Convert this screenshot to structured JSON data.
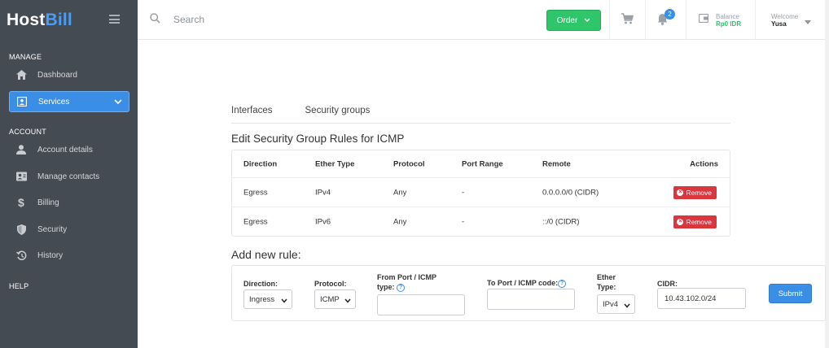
{
  "brand": {
    "host": "Host",
    "bill": "Bill"
  },
  "sidebar": {
    "sections": {
      "manage": "MANAGE",
      "account": "ACCOUNT",
      "help": "HELP"
    },
    "items": [
      {
        "label": "Dashboard",
        "icon": "home-icon"
      },
      {
        "label": "Services",
        "icon": "services-icon",
        "active": true
      },
      {
        "label": "Account details",
        "icon": "user-icon"
      },
      {
        "label": "Manage contacts",
        "icon": "contacts-icon"
      },
      {
        "label": "Billing",
        "icon": "dollar-icon"
      },
      {
        "label": "Security",
        "icon": "shield-icon"
      },
      {
        "label": "History",
        "icon": "history-icon"
      }
    ]
  },
  "topbar": {
    "search_placeholder": "Search",
    "order_label": "Order",
    "notifications_count": "2",
    "balance_label": "Balance",
    "balance_value": "Rp0 IDR",
    "welcome_label": "Welcome",
    "username": "Yusa"
  },
  "tabs": [
    "Interfaces",
    "Security groups"
  ],
  "heading": "Edit Security Group Rules for ICMP",
  "table": {
    "headers": [
      "Direction",
      "Ether Type",
      "Protocol",
      "Port Range",
      "Remote",
      "Actions"
    ],
    "rows": [
      {
        "direction": "Egress",
        "ether": "IPv4",
        "protocol": "Any",
        "port": "-",
        "remote": "0.0.0.0/0 (CIDR)",
        "action": "Remove"
      },
      {
        "direction": "Egress",
        "ether": "IPv6",
        "protocol": "Any",
        "port": "-",
        "remote": "::/0 (CIDR)",
        "action": "Remove"
      }
    ]
  },
  "add_rule": {
    "heading": "Add new rule:",
    "direction_label": "Direction:",
    "direction_value": "Ingress",
    "protocol_label": "Protocol:",
    "protocol_value": "ICMP",
    "from_port_label_1": "From Port / ICMP",
    "from_port_label_2": "type:",
    "from_port_value": "",
    "to_port_label": "To Port / ICMP code:",
    "to_port_value": "",
    "ether_label_1": "Ether",
    "ether_label_2": "Type:",
    "ether_value": "IPv4",
    "cidr_label": "CIDR:",
    "cidr_value": "10.43.102.0/24",
    "submit_label": "Submit"
  },
  "colors": {
    "sidebar_bg": "#454b53",
    "accent": "#3a8ee6",
    "order_green": "#2fc66b",
    "remove_red": "#d9363e"
  }
}
